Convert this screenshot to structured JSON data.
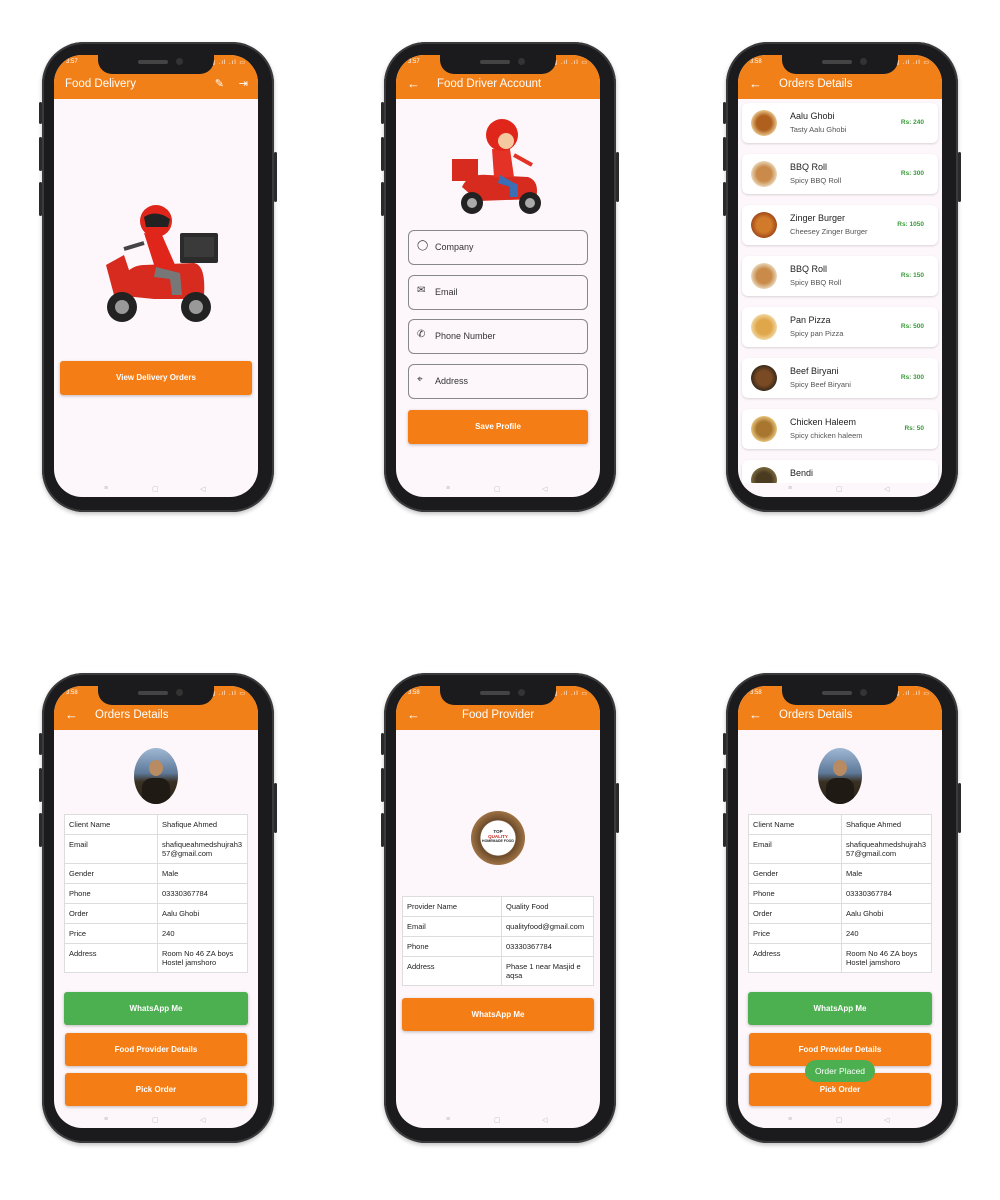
{
  "colors": {
    "accent": "#f28018",
    "button_orange": "#f57d15",
    "button_green": "#4caf50",
    "price_green": "#3a9a3a"
  },
  "status_times": [
    "3:57",
    "3:57",
    "3:58",
    "3:58",
    "3:58",
    "3:58"
  ],
  "status_icons": "▮▮ .ıl .ıl ▭",
  "nav": {
    "recent": "≡",
    "home": "▢",
    "back": "◁"
  },
  "icons": {
    "back": "←",
    "edit": "✎",
    "logout": "⇥",
    "person": "◯",
    "mail": "✉",
    "phone": "✆",
    "pin": "⌖"
  },
  "screen1": {
    "title": "Food Delivery",
    "button": "View Delivery Orders"
  },
  "screen2": {
    "title": "Food Driver Account",
    "fields": [
      "Company",
      "Email",
      "Phone Number",
      "Address"
    ],
    "button": "Save Profile"
  },
  "screen3": {
    "title": "Orders Details",
    "orders": [
      {
        "name": "Aalu Ghobi",
        "desc": "Tasty Aalu Ghobi",
        "price": "Rs: 240"
      },
      {
        "name": "BBQ Roll",
        "desc": "Spicy BBQ Roll",
        "price": "Rs: 300"
      },
      {
        "name": "Zinger Burger",
        "desc": "Cheesey Zinger Burger",
        "price": "Rs: 1050"
      },
      {
        "name": "BBQ Roll",
        "desc": "Spicy BBQ Roll",
        "price": "Rs: 150"
      },
      {
        "name": "Pan Pizza",
        "desc": "Spicy pan Pizza",
        "price": "Rs: 500"
      },
      {
        "name": "Beef Biryani",
        "desc": "Spicy Beef Biryani",
        "price": "Rs: 300"
      },
      {
        "name": "Chicken Haleem",
        "desc": "Spicy chicken haleem",
        "price": "Rs: 50"
      },
      {
        "name": "Bendi",
        "desc": "",
        "price": ""
      }
    ]
  },
  "screen4": {
    "title": "Orders Details",
    "rows": [
      {
        "k": "Client Name",
        "v": "Shafique Ahmed"
      },
      {
        "k": "Email",
        "v": "shafiqueahmedshujrah357@gmail.com"
      },
      {
        "k": "Gender",
        "v": "Male"
      },
      {
        "k": "Phone",
        "v": "03330367784"
      },
      {
        "k": "Order",
        "v": "Aalu Ghobi"
      },
      {
        "k": "Price",
        "v": "240"
      },
      {
        "k": "Address",
        "v": "Room No 46 ZA boys Hostel jamshoro"
      }
    ],
    "whatsapp": "WhatsApp Me",
    "provider": "Food Provider Details",
    "pick": "Pick Order"
  },
  "screen5": {
    "title": "Food Provider",
    "logo_text": [
      "TOP",
      "QUALITY",
      "HOMEMADE FOOD"
    ],
    "rows": [
      {
        "k": "Provider Name",
        "v": "Quality Food"
      },
      {
        "k": "Email",
        "v": "qualityfood@gmail.com"
      },
      {
        "k": "Phone",
        "v": "03330367784"
      },
      {
        "k": "Address",
        "v": "Phase 1 near Masjid e aqsa"
      }
    ],
    "whatsapp": "WhatsApp Me"
  },
  "screen6": {
    "title": "Orders Details",
    "rows": [
      {
        "k": "Client Name",
        "v": "Shafique Ahmed"
      },
      {
        "k": "Email",
        "v": "shafiqueahmedshujrah357@gmail.com"
      },
      {
        "k": "Gender",
        "v": "Male"
      },
      {
        "k": "Phone",
        "v": "03330367784"
      },
      {
        "k": "Order",
        "v": "Aalu Ghobi"
      },
      {
        "k": "Price",
        "v": "240"
      },
      {
        "k": "Address",
        "v": "Room No 46 ZA boys Hostel jamshoro"
      }
    ],
    "whatsapp": "WhatsApp Me",
    "provider": "Food Provider Details",
    "pick": "Pick Order",
    "toast": "Order Placed"
  }
}
